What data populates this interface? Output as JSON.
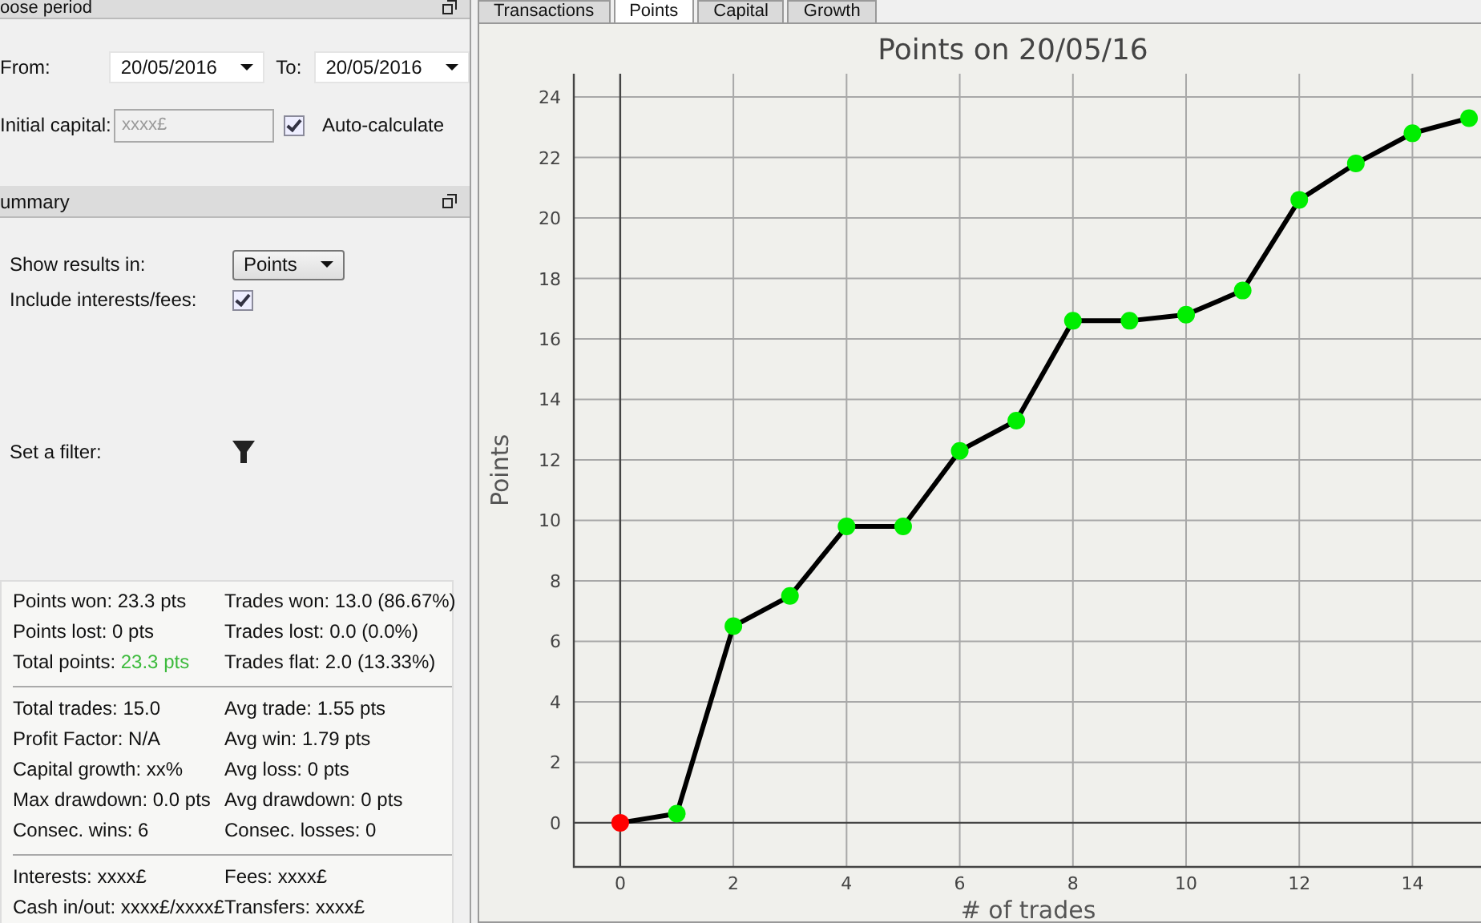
{
  "period": {
    "title": "oose period",
    "from_label": "From:",
    "from": "20/05/2016",
    "to_label": "To:",
    "to": "20/05/2016",
    "capital_label": "Initial capital:",
    "capital_placeholder": "xxxx£",
    "auto_label": "Auto-calculate",
    "auto_checked": true
  },
  "summary": {
    "title": "ummary",
    "show_label": "Show results in:",
    "show_value": "Points",
    "fees_label": "Include interests/fees:",
    "fees_checked": true,
    "filter_label": "Set a filter:"
  },
  "stats": [
    [
      {
        "label": "Points won:",
        "value": "23.3 pts",
        "positive": false
      },
      {
        "label": "Trades won:",
        "value": "13.0 (86.67%)",
        "positive": false
      },
      {
        "label": "Points lost:",
        "value": "0 pts",
        "positive": false
      },
      {
        "label": "Trades lost:",
        "value": "0.0 (0.0%)",
        "positive": false
      },
      {
        "label": "Total points:",
        "value": "23.3 pts",
        "positive": true
      },
      {
        "label": "Trades flat:",
        "value": "2.0 (13.33%)",
        "positive": false
      }
    ],
    [
      {
        "label": "Total trades:",
        "value": "15.0",
        "positive": false
      },
      {
        "label": "Avg trade:",
        "value": "1.55 pts",
        "positive": false
      },
      {
        "label": "Profit Factor:",
        "value": "N/A",
        "positive": false
      },
      {
        "label": "Avg win:",
        "value": "1.79 pts",
        "positive": false
      },
      {
        "label": "Capital growth:",
        "value": "xx%",
        "positive": false
      },
      {
        "label": "Avg loss:",
        "value": "0 pts",
        "positive": false
      },
      {
        "label": "Max drawdown:",
        "value": "0.0 pts",
        "positive": false
      },
      {
        "label": "Avg drawdown:",
        "value": "0 pts",
        "positive": false
      },
      {
        "label": "Consec. wins:",
        "value": "6",
        "positive": false
      },
      {
        "label": "Consec. losses:",
        "value": "0",
        "positive": false
      }
    ],
    [
      {
        "label": "Interests:",
        "value": "xxxx£",
        "positive": false
      },
      {
        "label": "Fees:",
        "value": "xxxx£",
        "positive": false
      },
      {
        "label": "Cash in/out:",
        "value": "xxxx£/xxxx£",
        "positive": false
      },
      {
        "label": "Transfers:",
        "value": "xxxx£",
        "positive": false
      }
    ]
  ],
  "tabs": [
    {
      "label": "Transactions",
      "selected": false
    },
    {
      "label": "Points",
      "selected": true
    },
    {
      "label": "Capital",
      "selected": false
    },
    {
      "label": "Growth",
      "selected": false
    }
  ],
  "chart": {
    "chart_data": {
      "type": "line",
      "grid": true,
      "title": "Points on 20/05/16",
      "xlabel": "# of trades",
      "ylabel": "Points",
      "x": [
        0,
        1,
        2,
        3,
        4,
        5,
        6,
        7,
        8,
        9,
        10,
        11,
        12,
        13,
        14,
        15
      ],
      "series": [
        {
          "color": "#000000",
          "marker": true,
          "values": [
            0,
            0.3,
            6.5,
            7.5,
            9.8,
            9.8,
            12.3,
            13.3,
            16.6,
            16.6,
            16.8,
            17.6,
            20.6,
            21.8,
            22.8,
            23.3
          ]
        }
      ],
      "xlim": [
        -0.82,
        15.24
      ],
      "ylim": [
        -1.46,
        24.77
      ],
      "xticks": [
        0,
        2,
        4,
        6,
        8,
        10,
        12,
        14
      ],
      "yticks": [
        0,
        2,
        4,
        6,
        8,
        10,
        12,
        14,
        16,
        18,
        20,
        22,
        24
      ]
    }
  }
}
